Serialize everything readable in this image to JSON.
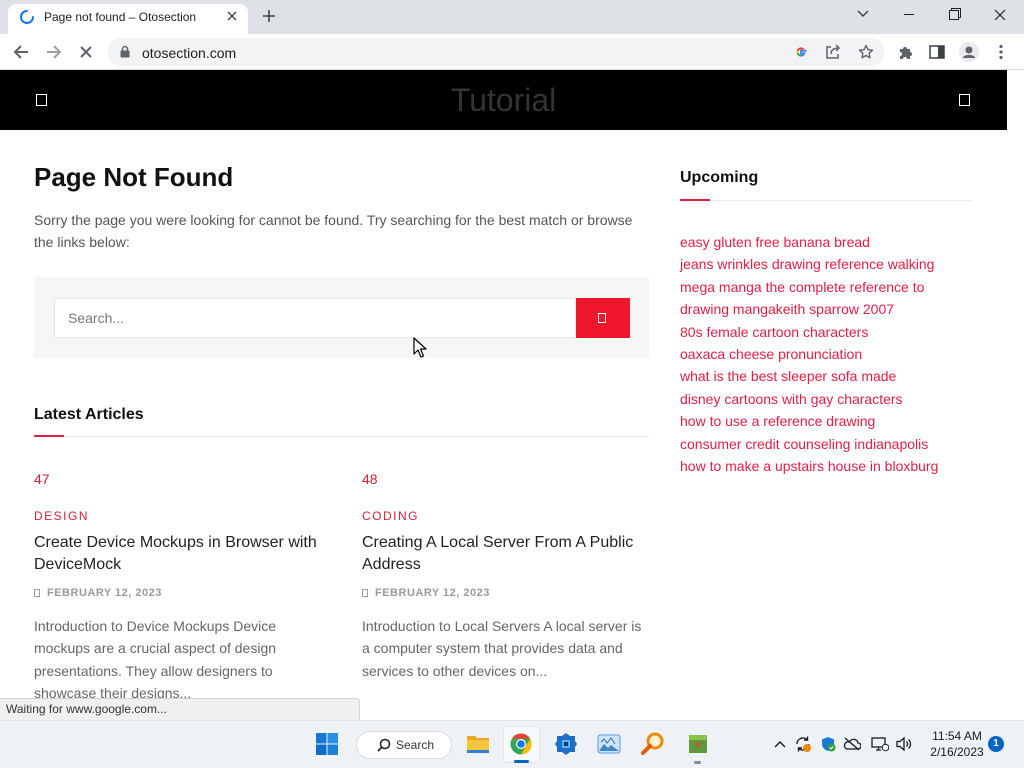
{
  "browser": {
    "tab": {
      "title": "Page not found – Otosection"
    },
    "address": {
      "url": "otosection.com"
    }
  },
  "site": {
    "header_title": "Tutorial",
    "not_found": {
      "heading": "Page Not Found",
      "message": "Sorry the page you were looking for cannot be found. Try searching for the best match or browse the links below:",
      "search_placeholder": "Search..."
    },
    "latest": {
      "heading": "Latest Articles",
      "articles": [
        {
          "number": "47",
          "category": "DESIGN",
          "title": "Create Device Mockups in Browser with DeviceMock",
          "date": "FEBRUARY 12, 2023",
          "excerpt": "Introduction to Device Mockups Device mockups are a crucial aspect of design presentations. They allow designers to showcase their designs..."
        },
        {
          "number": "48",
          "category": "CODING",
          "title": "Creating A Local Server From A Public Address",
          "date": "FEBRUARY 12, 2023",
          "excerpt": "Introduction to Local Servers A local server is a computer system that provides data and services to other devices on..."
        }
      ]
    },
    "sidebar": {
      "heading": "Upcoming",
      "links": [
        "easy gluten free banana bread",
        "jeans wrinkles drawing reference walking",
        "mega manga the complete reference to drawing mangakeith sparrow 2007",
        "80s female cartoon characters",
        "oaxaca cheese pronunciation",
        "what is the best sleeper sofa made",
        "disney cartoons with gay characters",
        "how to use a reference drawing",
        "consumer credit counseling indianapolis",
        "how to make a upstairs house in bloxburg"
      ]
    }
  },
  "status_bar": {
    "text": "Waiting for www.google.com..."
  },
  "taskbar": {
    "search_label": "Search",
    "time": "11:54 AM",
    "date": "2/16/2023",
    "notification_count": "1",
    "pinned_icons": [
      "windows-start-icon",
      "file-explorer-icon",
      "chrome-icon",
      "blue-app-icon",
      "photos-app-icon",
      "search-tool-icon",
      "package-app-icon"
    ],
    "tray_icons": [
      "chevron-up-icon",
      "sync-icon",
      "security-shield-icon",
      "onedrive-offline-icon",
      "network-icon",
      "speaker-icon"
    ]
  },
  "colors": {
    "accent": "#e31e45",
    "accent_dark": "#d91e36",
    "button": "#f0162c",
    "header_bg": "#000000"
  }
}
